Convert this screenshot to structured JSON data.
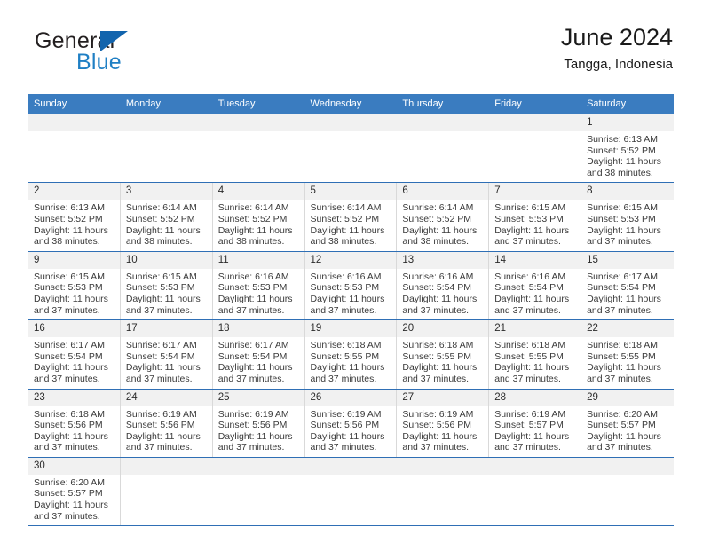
{
  "brand": {
    "name_top": "General",
    "name_bottom": "Blue",
    "color_dark": "#231f20",
    "color_blue": "#1f7fc4",
    "triangle_color": "#1264ad",
    "icon": "triangle-icon"
  },
  "header": {
    "title": "June 2024",
    "subtitle": "Tangga, Indonesia"
  },
  "theme": {
    "header_row_bg": "#3a7cc0",
    "header_row_text": "#ffffff",
    "daynum_bg": "#f1f1f1",
    "week_divider": "#2f6fb5",
    "cell_divider": "#d9d9d9"
  },
  "weekdays": [
    "Sunday",
    "Monday",
    "Tuesday",
    "Wednesday",
    "Thursday",
    "Friday",
    "Saturday"
  ],
  "labels": {
    "sunrise_prefix": "Sunrise:",
    "sunset_prefix": "Sunset:",
    "daylight_prefix": "Daylight:"
  },
  "weeks": [
    [
      {
        "day": "",
        "empty": true
      },
      {
        "day": "",
        "empty": true
      },
      {
        "day": "",
        "empty": true
      },
      {
        "day": "",
        "empty": true
      },
      {
        "day": "",
        "empty": true
      },
      {
        "day": "",
        "empty": true
      },
      {
        "day": "1",
        "sunrise": "Sunrise: 6:13 AM",
        "sunset": "Sunset: 5:52 PM",
        "daylight_1": "Daylight: 11 hours",
        "daylight_2": "and 38 minutes."
      }
    ],
    [
      {
        "day": "2",
        "sunrise": "Sunrise: 6:13 AM",
        "sunset": "Sunset: 5:52 PM",
        "daylight_1": "Daylight: 11 hours",
        "daylight_2": "and 38 minutes."
      },
      {
        "day": "3",
        "sunrise": "Sunrise: 6:14 AM",
        "sunset": "Sunset: 5:52 PM",
        "daylight_1": "Daylight: 11 hours",
        "daylight_2": "and 38 minutes."
      },
      {
        "day": "4",
        "sunrise": "Sunrise: 6:14 AM",
        "sunset": "Sunset: 5:52 PM",
        "daylight_1": "Daylight: 11 hours",
        "daylight_2": "and 38 minutes."
      },
      {
        "day": "5",
        "sunrise": "Sunrise: 6:14 AM",
        "sunset": "Sunset: 5:52 PM",
        "daylight_1": "Daylight: 11 hours",
        "daylight_2": "and 38 minutes."
      },
      {
        "day": "6",
        "sunrise": "Sunrise: 6:14 AM",
        "sunset": "Sunset: 5:52 PM",
        "daylight_1": "Daylight: 11 hours",
        "daylight_2": "and 38 minutes."
      },
      {
        "day": "7",
        "sunrise": "Sunrise: 6:15 AM",
        "sunset": "Sunset: 5:53 PM",
        "daylight_1": "Daylight: 11 hours",
        "daylight_2": "and 37 minutes."
      },
      {
        "day": "8",
        "sunrise": "Sunrise: 6:15 AM",
        "sunset": "Sunset: 5:53 PM",
        "daylight_1": "Daylight: 11 hours",
        "daylight_2": "and 37 minutes."
      }
    ],
    [
      {
        "day": "9",
        "sunrise": "Sunrise: 6:15 AM",
        "sunset": "Sunset: 5:53 PM",
        "daylight_1": "Daylight: 11 hours",
        "daylight_2": "and 37 minutes."
      },
      {
        "day": "10",
        "sunrise": "Sunrise: 6:15 AM",
        "sunset": "Sunset: 5:53 PM",
        "daylight_1": "Daylight: 11 hours",
        "daylight_2": "and 37 minutes."
      },
      {
        "day": "11",
        "sunrise": "Sunrise: 6:16 AM",
        "sunset": "Sunset: 5:53 PM",
        "daylight_1": "Daylight: 11 hours",
        "daylight_2": "and 37 minutes."
      },
      {
        "day": "12",
        "sunrise": "Sunrise: 6:16 AM",
        "sunset": "Sunset: 5:53 PM",
        "daylight_1": "Daylight: 11 hours",
        "daylight_2": "and 37 minutes."
      },
      {
        "day": "13",
        "sunrise": "Sunrise: 6:16 AM",
        "sunset": "Sunset: 5:54 PM",
        "daylight_1": "Daylight: 11 hours",
        "daylight_2": "and 37 minutes."
      },
      {
        "day": "14",
        "sunrise": "Sunrise: 6:16 AM",
        "sunset": "Sunset: 5:54 PM",
        "daylight_1": "Daylight: 11 hours",
        "daylight_2": "and 37 minutes."
      },
      {
        "day": "15",
        "sunrise": "Sunrise: 6:17 AM",
        "sunset": "Sunset: 5:54 PM",
        "daylight_1": "Daylight: 11 hours",
        "daylight_2": "and 37 minutes."
      }
    ],
    [
      {
        "day": "16",
        "sunrise": "Sunrise: 6:17 AM",
        "sunset": "Sunset: 5:54 PM",
        "daylight_1": "Daylight: 11 hours",
        "daylight_2": "and 37 minutes."
      },
      {
        "day": "17",
        "sunrise": "Sunrise: 6:17 AM",
        "sunset": "Sunset: 5:54 PM",
        "daylight_1": "Daylight: 11 hours",
        "daylight_2": "and 37 minutes."
      },
      {
        "day": "18",
        "sunrise": "Sunrise: 6:17 AM",
        "sunset": "Sunset: 5:54 PM",
        "daylight_1": "Daylight: 11 hours",
        "daylight_2": "and 37 minutes."
      },
      {
        "day": "19",
        "sunrise": "Sunrise: 6:18 AM",
        "sunset": "Sunset: 5:55 PM",
        "daylight_1": "Daylight: 11 hours",
        "daylight_2": "and 37 minutes."
      },
      {
        "day": "20",
        "sunrise": "Sunrise: 6:18 AM",
        "sunset": "Sunset: 5:55 PM",
        "daylight_1": "Daylight: 11 hours",
        "daylight_2": "and 37 minutes."
      },
      {
        "day": "21",
        "sunrise": "Sunrise: 6:18 AM",
        "sunset": "Sunset: 5:55 PM",
        "daylight_1": "Daylight: 11 hours",
        "daylight_2": "and 37 minutes."
      },
      {
        "day": "22",
        "sunrise": "Sunrise: 6:18 AM",
        "sunset": "Sunset: 5:55 PM",
        "daylight_1": "Daylight: 11 hours",
        "daylight_2": "and 37 minutes."
      }
    ],
    [
      {
        "day": "23",
        "sunrise": "Sunrise: 6:18 AM",
        "sunset": "Sunset: 5:56 PM",
        "daylight_1": "Daylight: 11 hours",
        "daylight_2": "and 37 minutes."
      },
      {
        "day": "24",
        "sunrise": "Sunrise: 6:19 AM",
        "sunset": "Sunset: 5:56 PM",
        "daylight_1": "Daylight: 11 hours",
        "daylight_2": "and 37 minutes."
      },
      {
        "day": "25",
        "sunrise": "Sunrise: 6:19 AM",
        "sunset": "Sunset: 5:56 PM",
        "daylight_1": "Daylight: 11 hours",
        "daylight_2": "and 37 minutes."
      },
      {
        "day": "26",
        "sunrise": "Sunrise: 6:19 AM",
        "sunset": "Sunset: 5:56 PM",
        "daylight_1": "Daylight: 11 hours",
        "daylight_2": "and 37 minutes."
      },
      {
        "day": "27",
        "sunrise": "Sunrise: 6:19 AM",
        "sunset": "Sunset: 5:56 PM",
        "daylight_1": "Daylight: 11 hours",
        "daylight_2": "and 37 minutes."
      },
      {
        "day": "28",
        "sunrise": "Sunrise: 6:19 AM",
        "sunset": "Sunset: 5:57 PM",
        "daylight_1": "Daylight: 11 hours",
        "daylight_2": "and 37 minutes."
      },
      {
        "day": "29",
        "sunrise": "Sunrise: 6:20 AM",
        "sunset": "Sunset: 5:57 PM",
        "daylight_1": "Daylight: 11 hours",
        "daylight_2": "and 37 minutes."
      }
    ],
    [
      {
        "day": "30",
        "sunrise": "Sunrise: 6:20 AM",
        "sunset": "Sunset: 5:57 PM",
        "daylight_1": "Daylight: 11 hours",
        "daylight_2": "and 37 minutes."
      },
      {
        "day": "",
        "empty": true
      },
      {
        "day": "",
        "empty": true
      },
      {
        "day": "",
        "empty": true
      },
      {
        "day": "",
        "empty": true
      },
      {
        "day": "",
        "empty": true
      },
      {
        "day": "",
        "empty": true
      }
    ]
  ]
}
